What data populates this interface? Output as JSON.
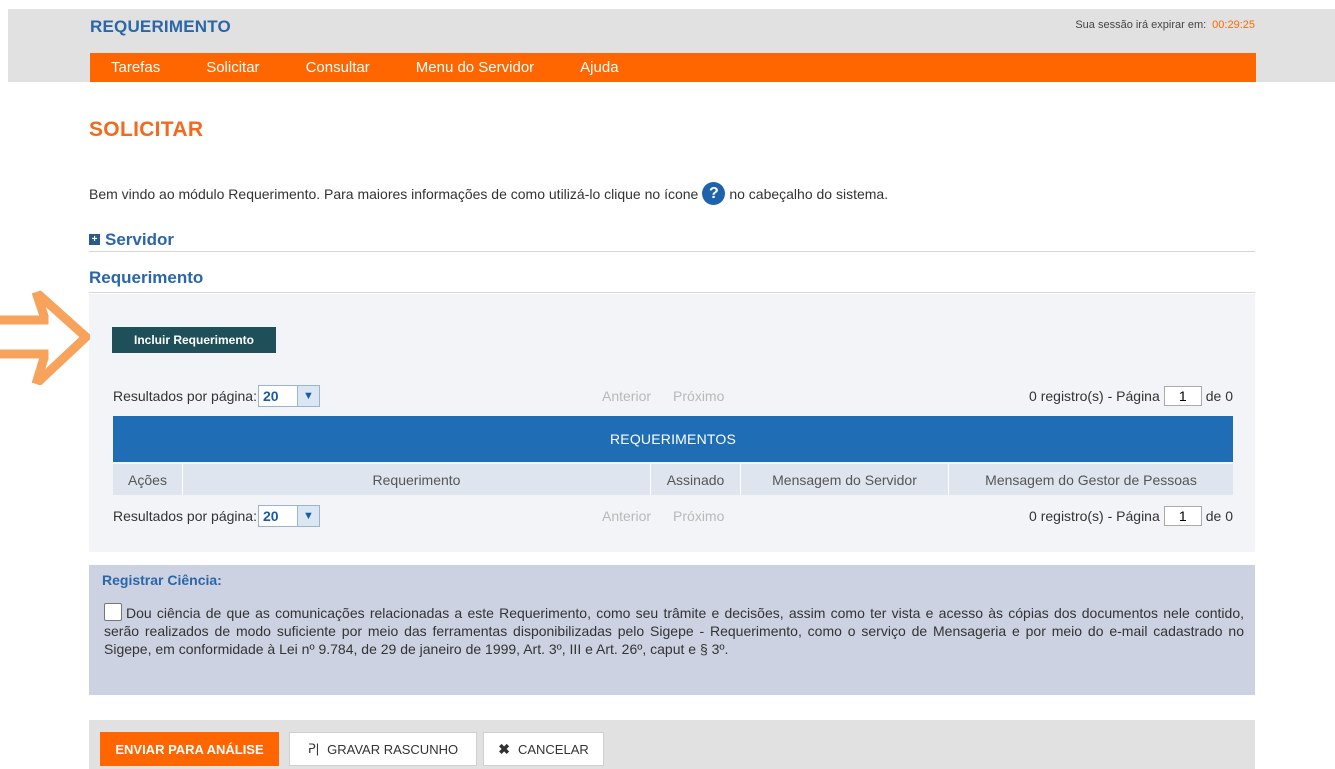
{
  "header": {
    "app_title": "REQUERIMENTO",
    "session_label": "Sua sessão irá expirar em:",
    "session_timer": "00:29:25"
  },
  "nav": {
    "items": [
      {
        "label": "Tarefas"
      },
      {
        "label": "Solicitar"
      },
      {
        "label": "Consultar"
      },
      {
        "label": "Menu do Servidor"
      },
      {
        "label": "Ajuda"
      }
    ]
  },
  "page": {
    "title": "SOLICITAR",
    "welcome_before": "Bem vindo ao módulo Requerimento. Para maiores informações de como utilizá-lo clique no ícone",
    "welcome_after": "no cabeçalho do sistema.",
    "help_icon_glyph": "?"
  },
  "sections": {
    "servidor": "Servidor",
    "servidor_icon_glyph": "+",
    "requerimento": "Requerimento"
  },
  "requerimento_panel": {
    "incluir_button": "Incluir Requerimento",
    "pager": {
      "results_per_page_label": "Resultados por página:",
      "results_per_page_value": "20",
      "dropdown_glyph": "▼",
      "previous": "Anterior",
      "next": "Próximo",
      "records_label": "0 registro(s) - Página",
      "page_value": "1",
      "of_label": "de 0"
    },
    "table": {
      "title": "REQUERIMENTOS",
      "columns": [
        "Ações",
        "Requerimento",
        "Assinado",
        "Mensagem do Servidor",
        "Mensagem do Gestor de Pessoas"
      ]
    }
  },
  "ciencia": {
    "title": "Registrar Ciência:",
    "text": "Dou ciência de que as comunicações relacionadas a este Requerimento, como seu trâmite e decisões, assim como ter vista e acesso às cópias dos documentos nele contido, serão realizados de modo suficiente por meio das ferramentas disponibilizadas pelo Sigepe - Requerimento, como o serviço de Mensageria e por meio do e-mail cadastrado no Sigepe, em conformidade à Lei nº 9.784, de 29 de janeiro de 1999, Art. 3º, III e Art. 26º, caput e § 3º."
  },
  "footer": {
    "enviar": "ENVIAR PARA ANÁLISE",
    "gravar": "GRAVAR RASCUNHO",
    "gravar_icon_glyph": "ᕈ|",
    "cancelar": "CANCELAR",
    "cancelar_icon_glyph": "✖"
  },
  "colors": {
    "accent_orange": "#ff6600",
    "title_blue": "#2a66a8",
    "table_header_blue": "#1e6db5",
    "include_button": "#1f4f59",
    "annotation_arrow": "#f7a35c"
  }
}
